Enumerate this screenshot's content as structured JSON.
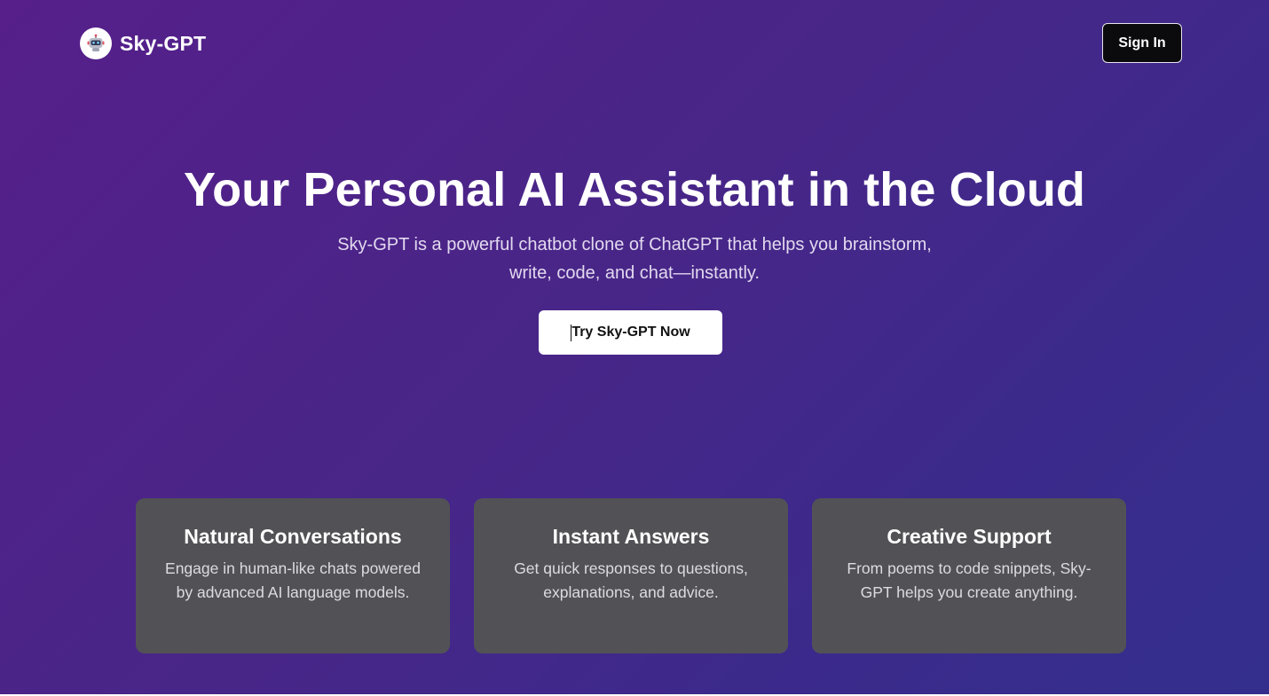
{
  "header": {
    "brand_name": "Sky-GPT",
    "logo_icon": "robot-icon",
    "signin_label": "Sign In"
  },
  "hero": {
    "title": "Your Personal AI Assistant in the Cloud",
    "subtitle": "Sky-GPT is a powerful chatbot clone of ChatGPT that helps you brainstorm, write, code, and chat—instantly.",
    "cta_label": "Try Sky-GPT Now"
  },
  "features": [
    {
      "title": "Natural Conversations",
      "text": "Engage in human-like chats powered by advanced AI language models."
    },
    {
      "title": "Instant Answers",
      "text": "Get quick responses to questions, explanations, and advice."
    },
    {
      "title": "Creative Support",
      "text": "From poems to code snippets, Sky-GPT helps you create anything."
    }
  ],
  "colors": {
    "gradient_start": "#561f8a",
    "gradient_end": "#342f8c",
    "card_bg": "#525256",
    "signin_bg": "#0b0b0d",
    "cta_bg": "#ffffff"
  }
}
